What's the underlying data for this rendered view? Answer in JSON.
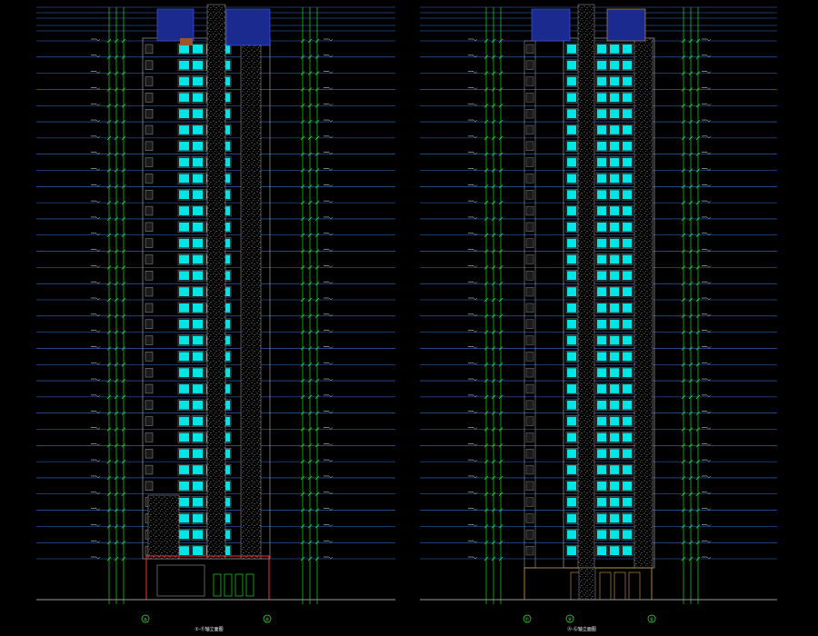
{
  "drawing": {
    "background": "#000000",
    "colors": {
      "level_line": "#3a6fd8",
      "dimension": "#22ff22",
      "window_glass": "#00e5e5",
      "facade_frame": "#7a7a7a",
      "stone_texture": "#cfcfcf",
      "roof_panel": "#1b2a8f",
      "podium_outline": "#ff3030",
      "text": "#e8e8e8"
    },
    "floor_count": 32,
    "elevations": [
      {
        "id": "left-elevation",
        "title": "①-⑪轴立面图",
        "axis_labels": [
          "①",
          "⑪"
        ]
      },
      {
        "id": "right-elevation",
        "title": "Ⓐ-Ⓖ轴立面图",
        "axis_labels": [
          "Ⓕ",
          "Ⓐ",
          "Ⓖ"
        ]
      }
    ]
  }
}
